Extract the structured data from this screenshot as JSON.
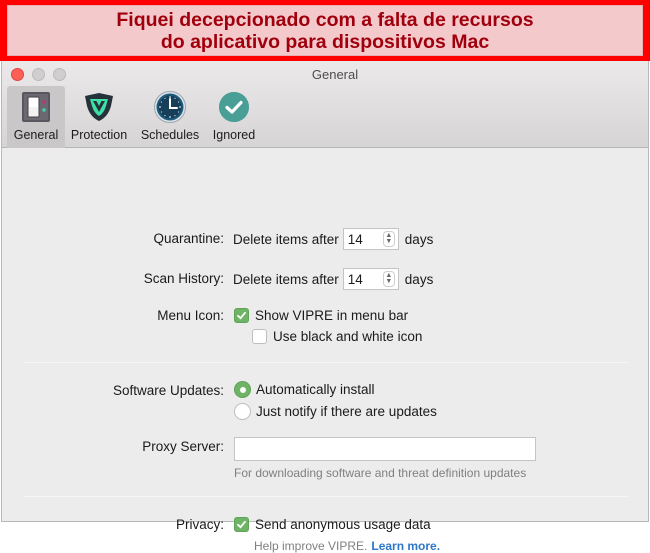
{
  "banner": {
    "line1": "Fiquei decepcionado com a falta de recursos",
    "line2": "do aplicativo para dispositivos Mac"
  },
  "window": {
    "title": "General",
    "traffic_lights": [
      "close",
      "minimize",
      "maximize"
    ]
  },
  "toolbar": {
    "tabs": [
      {
        "label": "General",
        "icon": "switch-panel-icon",
        "active": true
      },
      {
        "label": "Protection",
        "icon": "shield-icon",
        "active": false
      },
      {
        "label": "Schedules",
        "icon": "clock-icon",
        "active": false
      },
      {
        "label": "Ignored",
        "icon": "checkmark-circle-icon",
        "active": false
      }
    ]
  },
  "settings": {
    "quarantine": {
      "label": "Quarantine:",
      "prefix": "Delete items after",
      "value": "14",
      "suffix": "days"
    },
    "scan_history": {
      "label": "Scan History:",
      "prefix": "Delete items after",
      "value": "14",
      "suffix": "days"
    },
    "menu_icon": {
      "label": "Menu Icon:",
      "options": [
        {
          "label": "Show VIPRE in menu bar",
          "checked": true
        },
        {
          "label": "Use black and white icon",
          "checked": false
        }
      ]
    },
    "software_updates": {
      "label": "Software Updates:",
      "options": [
        {
          "label": "Automatically install",
          "selected": true
        },
        {
          "label": "Just notify if there are updates",
          "selected": false
        }
      ]
    },
    "proxy_server": {
      "label": "Proxy Server:",
      "value": "",
      "hint": "For downloading software and threat definition updates"
    },
    "privacy": {
      "label": "Privacy:",
      "option": {
        "label": "Send anonymous usage data",
        "checked": true
      },
      "hint": "Help improve VIPRE.",
      "link": "Learn more."
    }
  },
  "colors": {
    "banner_red": "#ff0000",
    "banner_text": "#a0000d",
    "accent_green": "#6fb366",
    "link_blue": "#2c77c8"
  }
}
